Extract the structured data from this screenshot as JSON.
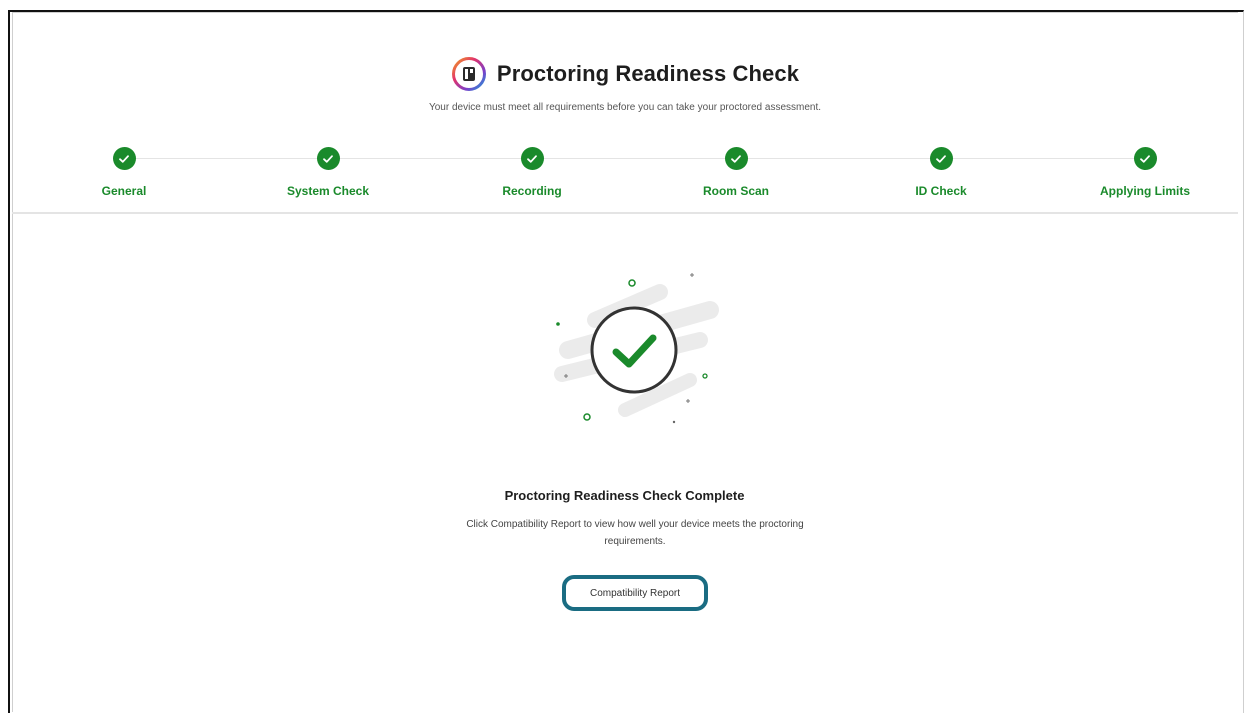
{
  "header": {
    "title": "Proctoring Readiness Check",
    "subtitle": "Your device must meet all requirements before you can take your proctored assessment."
  },
  "steps": [
    {
      "label": "General",
      "status": "complete"
    },
    {
      "label": "System Check",
      "status": "complete"
    },
    {
      "label": "Recording",
      "status": "complete"
    },
    {
      "label": "Room Scan",
      "status": "complete"
    },
    {
      "label": "ID Check",
      "status": "complete"
    },
    {
      "label": "Applying Limits",
      "status": "complete"
    }
  ],
  "completion": {
    "title": "Proctoring Readiness Check Complete",
    "description": "Click Compatibility Report to view how well your device meets the proctoring requirements.",
    "button_label": "Compatibility Report"
  },
  "colors": {
    "success": "#1a8a2b",
    "button_border": "#1a6c82"
  },
  "icons": {
    "logo": "proctoring-logo-icon",
    "step": "check-circle-icon",
    "hero": "large-check-icon"
  }
}
